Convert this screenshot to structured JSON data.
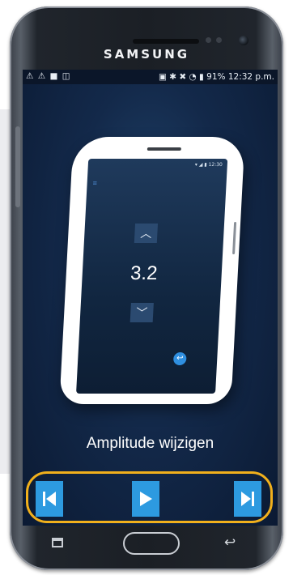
{
  "phone": {
    "brand": "SAMSUNG",
    "statusbar": {
      "left_icons": "⚠ ⚠ ■ ◫",
      "right_text": "91% 12:32 p.m."
    }
  },
  "app": {
    "inner_device": {
      "status_time": "12:30",
      "up_icon": "chevron-up-icon",
      "value": "3.2",
      "down_icon": "chevron-down-icon"
    },
    "caption": "Amplitude wijzigen",
    "controls": {
      "prev_icon": "skip-previous-icon",
      "play_icon": "play-icon",
      "next_icon": "skip-next-icon"
    }
  },
  "colors": {
    "accent": "#2d9ae0",
    "highlight": "#f1b01c",
    "screen_bg": "#13294a"
  }
}
